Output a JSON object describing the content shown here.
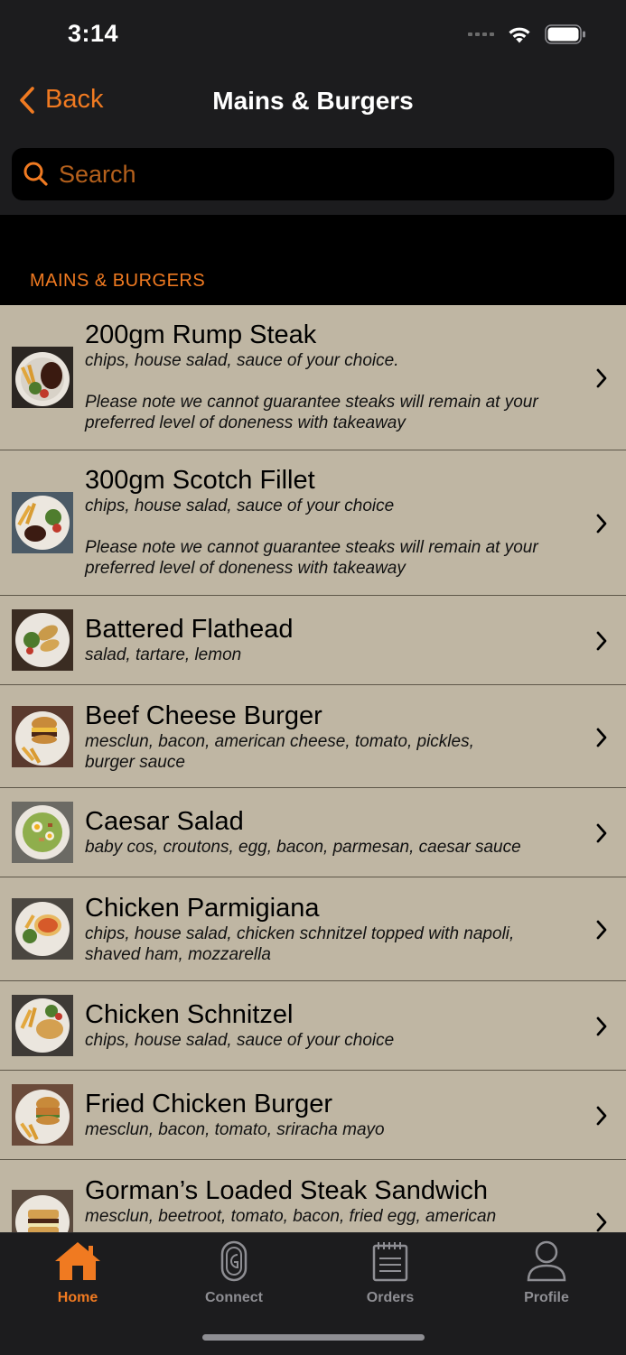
{
  "status_bar": {
    "time": "3:14"
  },
  "nav": {
    "back_label": "Back",
    "title": "Mains & Burgers"
  },
  "search": {
    "placeholder": "Search",
    "value": ""
  },
  "section": {
    "header": "MAINS & BURGERS"
  },
  "items": [
    {
      "name": "200gm Rump Steak",
      "description": "chips, house salad, sauce of your choice.\n\nPlease note we cannot guarantee steaks will remain at your preferred level of doneness with takeaway"
    },
    {
      "name": "300gm Scotch Fillet",
      "description": "chips, house salad, sauce of your choice\n\nPlease note we cannot guarantee steaks will remain at your preferred level of doneness with takeaway"
    },
    {
      "name": "Battered Flathead",
      "description": "salad, tartare, lemon"
    },
    {
      "name": "Beef Cheese Burger",
      "description": "mesclun, bacon, american cheese, tomato, pickles,\nburger sauce"
    },
    {
      "name": "Caesar Salad",
      "description": "baby cos, croutons, egg, bacon, parmesan, caesar sauce"
    },
    {
      "name": "Chicken Parmigiana",
      "description": "chips, house salad, chicken schnitzel topped with napoli,\nshaved ham, mozzarella"
    },
    {
      "name": "Chicken Schnitzel",
      "description": "chips, house salad, sauce of your choice"
    },
    {
      "name": "Fried Chicken Burger",
      "description": "mesclun, bacon, tomato, sriracha mayo"
    },
    {
      "name": "Gorman’s Loaded Steak Sandwich",
      "description": "mesclun, beetroot, tomato, bacon, fried egg, american"
    }
  ],
  "tabs": [
    {
      "label": "Home",
      "icon": "house-icon",
      "active": true
    },
    {
      "label": "Connect",
      "icon": "connect-icon",
      "active": false
    },
    {
      "label": "Orders",
      "icon": "orders-icon",
      "active": false
    },
    {
      "label": "Profile",
      "icon": "person-icon",
      "active": false
    }
  ],
  "colors": {
    "accent": "#f07a21",
    "list_background": "#bfb6a3",
    "bar_background": "#1c1c1e"
  }
}
